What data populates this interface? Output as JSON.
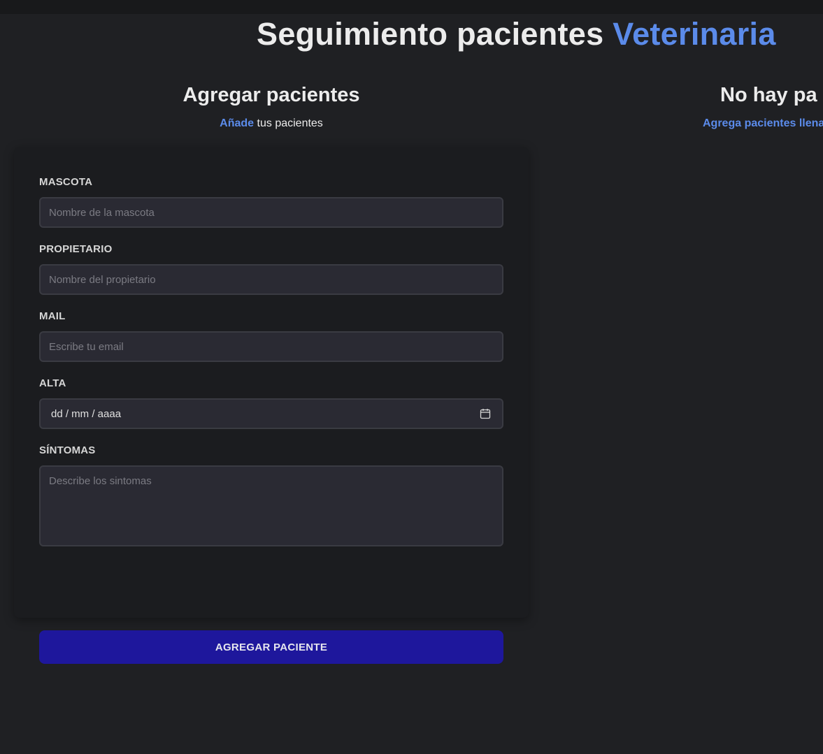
{
  "header": {
    "title_main": "Seguimiento pacientes ",
    "title_accent": "Veterinaria"
  },
  "form_section": {
    "heading": "Agregar pacientes",
    "subtitle_accent": "Añade",
    "subtitle_rest": " tus pacientes"
  },
  "form": {
    "mascota": {
      "label": "MASCOTA",
      "placeholder": "Nombre de la mascota",
      "value": ""
    },
    "propietario": {
      "label": "PROPIETARIO",
      "placeholder": "Nombre del propietario",
      "value": ""
    },
    "mail": {
      "label": "MAIL",
      "placeholder": "Escribe tu email",
      "value": ""
    },
    "alta": {
      "label": "ALTA",
      "display": "dd / mm / aaaa",
      "icon": "calendar-icon"
    },
    "sintomas": {
      "label": "SÍNTOMAS",
      "placeholder": "Describe los sintomas",
      "value": ""
    },
    "submit_label": "AGREGAR PACIENTE"
  },
  "list_section": {
    "heading": "No hay pa",
    "subtitle": "Agrega pacientes llenar"
  },
  "colors": {
    "background": "#1f2023",
    "accent": "#5b8bea",
    "button": "#1e179c",
    "card": "#1b1c1f",
    "input": "#2a2a33"
  }
}
